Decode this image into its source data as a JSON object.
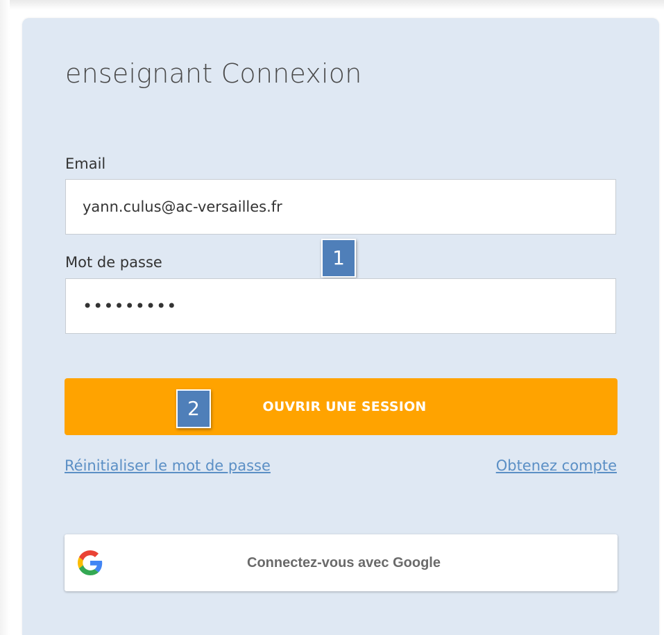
{
  "page": {
    "title": "enseignant Connexion"
  },
  "form": {
    "email_label": "Email",
    "email_value": "yann.culus@ac-versailles.fr",
    "password_label": "Mot de passe",
    "password_value": "•••••••••",
    "submit_label": "OUVRIR UNE SESSION"
  },
  "links": {
    "reset_password": "Réinitialiser le mot de passe",
    "get_account": "Obtenez compte"
  },
  "google": {
    "label": "Connectez-vous avec Google",
    "icon": "google-icon"
  },
  "callouts": {
    "one": "1",
    "two": "2"
  },
  "colors": {
    "card_background": "#dfe8f3",
    "submit_button": "#ffa300",
    "link": "#5b8fc5",
    "callout": "#4f7fb9"
  }
}
